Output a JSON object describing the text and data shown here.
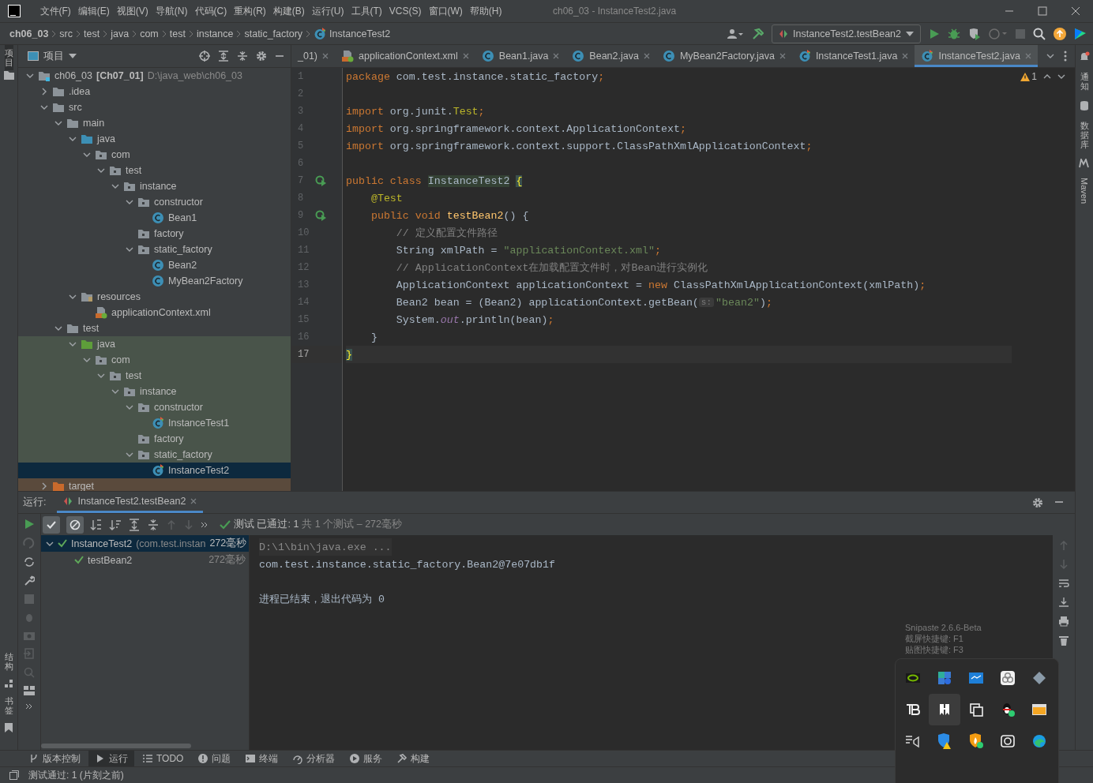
{
  "title_bar": {
    "menus": [
      "文件(F)",
      "编辑(E)",
      "视图(V)",
      "导航(N)",
      "代码(C)",
      "重构(R)",
      "构建(B)",
      "运行(U)",
      "工具(T)",
      "VCS(S)",
      "窗口(W)",
      "帮助(H)"
    ],
    "title": "ch06_03 - InstanceTest2.java"
  },
  "breadcrumbs": [
    "ch06_03",
    "src",
    "test",
    "java",
    "com",
    "test",
    "instance",
    "static_factory",
    "InstanceTest2"
  ],
  "run_config": "InstanceTest2.testBean2",
  "left_stripe": {
    "top": "项目",
    "bottom": [
      "结构",
      "书签"
    ]
  },
  "right_stripe": [
    "通知",
    "数据库",
    "Maven"
  ],
  "project_panel": {
    "title": "项目",
    "tree": [
      {
        "name": "ch06_03",
        "module": "[Ch07_01]",
        "path": "D:\\java_web\\ch06_03",
        "kind": "module",
        "expanded": true,
        "selected": false,
        "children": [
          {
            "name": ".idea",
            "kind": "folder",
            "expanded": false,
            "selected": false
          },
          {
            "name": "src",
            "kind": "folder",
            "expanded": true,
            "selected": false,
            "children": [
              {
                "name": "main",
                "kind": "folder",
                "expanded": true,
                "selected": false,
                "children": [
                  {
                    "name": "java",
                    "kind": "source",
                    "expanded": true,
                    "selected": false,
                    "children": [
                      {
                        "name": "com",
                        "kind": "package",
                        "expanded": true,
                        "selected": false,
                        "children": [
                          {
                            "name": "test",
                            "kind": "package",
                            "expanded": true,
                            "selected": false,
                            "children": [
                              {
                                "name": "instance",
                                "kind": "package",
                                "expanded": true,
                                "selected": false,
                                "children": [
                                  {
                                    "name": "constructor",
                                    "kind": "package",
                                    "expanded": true,
                                    "selected": false,
                                    "children": [
                                      {
                                        "name": "Bean1",
                                        "kind": "class",
                                        "selected": false
                                      }
                                    ]
                                  },
                                  {
                                    "name": "factory",
                                    "kind": "package",
                                    "selected": false
                                  },
                                  {
                                    "name": "static_factory",
                                    "kind": "package",
                                    "expanded": true,
                                    "selected": false,
                                    "children": [
                                      {
                                        "name": "Bean2",
                                        "kind": "class",
                                        "selected": false
                                      },
                                      {
                                        "name": "MyBean2Factory",
                                        "kind": "class",
                                        "selected": false
                                      }
                                    ]
                                  }
                                ]
                              }
                            ]
                          }
                        ]
                      }
                    ]
                  },
                  {
                    "name": "resources",
                    "kind": "resources",
                    "expanded": true,
                    "selected": false,
                    "children": [
                      {
                        "name": "applicationContext.xml",
                        "kind": "xml",
                        "selected": false
                      }
                    ]
                  }
                ]
              },
              {
                "name": "test",
                "kind": "folder",
                "expanded": true,
                "selected": false,
                "children": [
                  {
                    "name": "java",
                    "kind": "test-source",
                    "expanded": true,
                    "selected": false,
                    "children": [
                      {
                        "name": "com",
                        "kind": "package",
                        "expanded": true,
                        "selected": false,
                        "children": [
                          {
                            "name": "test",
                            "kind": "package",
                            "expanded": true,
                            "selected": false,
                            "children": [
                              {
                                "name": "instance",
                                "kind": "package",
                                "expanded": true,
                                "selected": false,
                                "children": [
                                  {
                                    "name": "constructor",
                                    "kind": "package",
                                    "expanded": true,
                                    "selected": false,
                                    "children": [
                                      {
                                        "name": "InstanceTest1",
                                        "kind": "test-class",
                                        "selected": false
                                      }
                                    ]
                                  },
                                  {
                                    "name": "factory",
                                    "kind": "package",
                                    "selected": false
                                  },
                                  {
                                    "name": "static_factory",
                                    "kind": "package",
                                    "expanded": true,
                                    "selected": false,
                                    "children": [
                                      {
                                        "name": "InstanceTest2",
                                        "kind": "test-class",
                                        "selected": true
                                      }
                                    ]
                                  }
                                ]
                              }
                            ]
                          }
                        ]
                      }
                    ]
                  }
                ]
              }
            ]
          },
          {
            "name": "target",
            "kind": "excluded",
            "expanded": false,
            "selected": false
          }
        ]
      }
    ]
  },
  "editor_tabs": [
    {
      "label": "_01)",
      "kind": "partial",
      "selected": false
    },
    {
      "label": "applicationContext.xml",
      "kind": "xml",
      "selected": false
    },
    {
      "label": "Bean1.java",
      "kind": "class",
      "selected": false
    },
    {
      "label": "Bean2.java",
      "kind": "class",
      "selected": false
    },
    {
      "label": "MyBean2Factory.java",
      "kind": "class",
      "selected": false
    },
    {
      "label": "InstanceTest1.java",
      "kind": "test-class",
      "selected": false
    },
    {
      "label": "InstanceTest2.java",
      "kind": "test-class",
      "selected": true
    }
  ],
  "editor": {
    "warnings": "1",
    "lines": [
      {
        "number": "1",
        "current": false,
        "runnable": false,
        "tokens": [
          {
            "text": "package",
            "kind": "kw"
          },
          {
            "text": " com.test.instance.static_factory",
            "kind": "plain"
          },
          {
            "text": ";",
            "kind": "kw"
          }
        ]
      },
      {
        "number": "2",
        "current": false,
        "runnable": false
      },
      {
        "number": "3",
        "current": false,
        "runnable": false,
        "tokens": [
          {
            "text": "import",
            "kind": "kw"
          },
          {
            "text": " org.junit.",
            "kind": "plain"
          },
          {
            "text": "Test",
            "kind": "ann"
          },
          {
            "text": ";",
            "kind": "kw"
          }
        ]
      },
      {
        "number": "4",
        "current": false,
        "runnable": false,
        "tokens": [
          {
            "text": "import",
            "kind": "kw"
          },
          {
            "text": " org.springframework.context.ApplicationContext",
            "kind": "plain"
          },
          {
            "text": ";",
            "kind": "kw"
          }
        ]
      },
      {
        "number": "5",
        "current": false,
        "runnable": false,
        "tokens": [
          {
            "text": "import",
            "kind": "kw"
          },
          {
            "text": " org.springframework.context.support.ClassPathXmlApplicationContext",
            "kind": "plain"
          },
          {
            "text": ";",
            "kind": "kw"
          }
        ]
      },
      {
        "number": "6",
        "current": false,
        "runnable": false
      },
      {
        "number": "7",
        "current": false,
        "runnable": true,
        "tokens": [
          {
            "text": "public class ",
            "kind": "kw"
          },
          {
            "text": "InstanceTest2",
            "kind": "mark"
          },
          {
            "text": "{",
            "kind": "brace"
          }
        ]
      },
      {
        "number": "8",
        "current": false,
        "runnable": false,
        "tokens": [
          {
            "text": "    @Test",
            "kind": "ann"
          }
        ]
      },
      {
        "number": "9",
        "current": false,
        "runnable": true,
        "tokens": [
          {
            "text": "    public void ",
            "kind": "kw"
          },
          {
            "text": "testBean2",
            "kind": "fn"
          },
          {
            "text": "() {",
            "kind": "plain"
          }
        ]
      },
      {
        "number": "10",
        "current": false,
        "runnable": false,
        "tokens": [
          {
            "text": "        // 定义配置文件路径",
            "kind": "comment"
          }
        ]
      },
      {
        "number": "11",
        "current": false,
        "runnable": false,
        "tokens": [
          {
            "text": "        String xmlPath = ",
            "kind": "plain"
          },
          {
            "text": "\"applicationContext.xml\"",
            "kind": "str"
          },
          {
            "text": ";",
            "kind": "kw"
          }
        ]
      },
      {
        "number": "12",
        "current": false,
        "runnable": false,
        "tokens": [
          {
            "text": "        // ApplicationContext在加载配置文件时，对Bean进行实例化",
            "kind": "comment"
          }
        ]
      },
      {
        "number": "13",
        "current": false,
        "runnable": false,
        "tokens": [
          {
            "text": "        ApplicationContext applicationContext = ",
            "kind": "plain"
          },
          {
            "text": "new ",
            "kind": "kw"
          },
          {
            "text": "ClassPathXmlApplicationContext(xmlPath)",
            "kind": "plain"
          },
          {
            "text": ";",
            "kind": "kw"
          }
        ]
      },
      {
        "number": "14",
        "current": false,
        "runnable": false,
        "tokens": [
          {
            "text": "        Bean2 bean = (Bean2) applicationContext.getBean(",
            "kind": "plain"
          },
          {
            "text": "s:",
            "kind": "hint"
          },
          {
            "text": "\"bean2\"",
            "kind": "str"
          },
          {
            "text": ")",
            "kind": "plain"
          },
          {
            "text": ";",
            "kind": "kw"
          }
        ]
      },
      {
        "number": "15",
        "current": false,
        "runnable": false,
        "tokens": [
          {
            "text": "        System.",
            "kind": "plain"
          },
          {
            "text": "out",
            "kind": "field"
          },
          {
            "text": ".println(bean)",
            "kind": "plain"
          },
          {
            "text": ";",
            "kind": "kw"
          }
        ]
      },
      {
        "number": "16",
        "current": false,
        "runnable": false,
        "tokens": [
          {
            "text": "    }",
            "kind": "plain"
          }
        ]
      },
      {
        "number": "17",
        "current": true,
        "runnable": false,
        "tokens": [
          {
            "text": "}",
            "kind": "brace"
          }
        ]
      }
    ]
  },
  "run_panel": {
    "label": "运行:",
    "tab": "InstanceTest2.testBean2",
    "filters": [
      {
        "kind": "passed",
        "selected": true
      },
      {
        "kind": "ignored",
        "selected": true
      }
    ],
    "status_main": "测试 已通过: 1",
    "status_rest": "共 1 个测试 – 272毫秒",
    "tests": [
      {
        "name": "InstanceTest2",
        "detail": "(com.test.instan",
        "time": "272毫秒",
        "expanded": true,
        "selected": true,
        "children": [
          {
            "name": "testBean2",
            "time": "272毫秒",
            "selected": false
          }
        ]
      }
    ],
    "console": [
      {
        "text": "D:\\1\\bin\\java.exe ...",
        "kind": "command"
      },
      {
        "text": "com.test.instance.static_factory.Bean2@7e07db1f",
        "kind": "output"
      },
      {
        "text": "进程已结束，退出代码为 0",
        "kind": "exit"
      }
    ]
  },
  "tool_windows": [
    {
      "label": "版本控制",
      "kind": "vcs",
      "selected": false
    },
    {
      "label": "运行",
      "kind": "run",
      "selected": true
    },
    {
      "label": "TODO",
      "kind": "todo",
      "selected": false
    },
    {
      "label": "问题",
      "kind": "problems",
      "selected": false
    },
    {
      "label": "终端",
      "kind": "terminal",
      "selected": false
    },
    {
      "label": "分析器",
      "kind": "profiler",
      "selected": false
    },
    {
      "label": "服务",
      "kind": "services",
      "selected": false
    },
    {
      "label": "构建",
      "kind": "build",
      "selected": false
    }
  ],
  "status_bar": "测试通过: 1 (片刻之前)",
  "snipaste_tooltip": [
    "Snipaste 2.6.6-Beta",
    "截屏快捷键: F1",
    "贴图快捷键: F3"
  ],
  "tray_popup": {
    "icons": [
      {
        "kind": "gpu",
        "selected": false
      },
      {
        "kind": "puzzle",
        "selected": false
      },
      {
        "kind": "screen",
        "selected": false
      },
      {
        "kind": "cloud",
        "selected": false
      },
      {
        "kind": "diamond",
        "selected": false
      },
      {
        "kind": "tb",
        "selected": false
      },
      {
        "kind": "bookmark",
        "selected": true
      },
      {
        "kind": "copy",
        "selected": false
      },
      {
        "kind": "penguin",
        "selected": false
      },
      {
        "kind": "window",
        "selected": false
      },
      {
        "kind": "speaker",
        "selected": false
      },
      {
        "kind": "shield-warning",
        "selected": false
      },
      {
        "kind": "shield-fire",
        "selected": false
      },
      {
        "kind": "camera",
        "selected": false
      },
      {
        "kind": "browser",
        "selected": false
      }
    ]
  }
}
